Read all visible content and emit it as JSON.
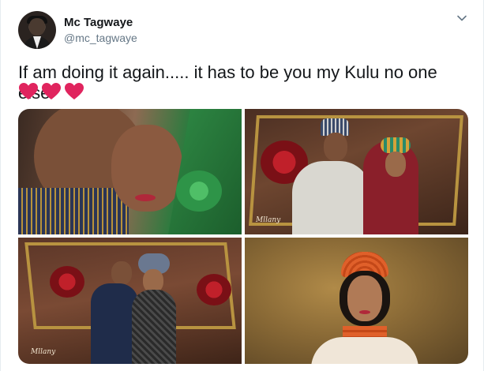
{
  "user": {
    "name": "Mc Tagwaye",
    "handle": "@mc_tagwaye"
  },
  "tweet": {
    "text": "If am doing it again..... it has to be you my Kulu no one else",
    "hearts_count": 3,
    "heart_color": "#e0245e"
  },
  "icons": {
    "menu": "chevron-down-icon",
    "avatar": "profile-avatar",
    "heart": "red-heart-emoji"
  },
  "colors": {
    "name_text": "#14171a",
    "handle_text": "#657786",
    "border": "#e6ecf0"
  },
  "media": {
    "count": 4,
    "watermarks": [
      "Mllany",
      "Mllany"
    ]
  }
}
